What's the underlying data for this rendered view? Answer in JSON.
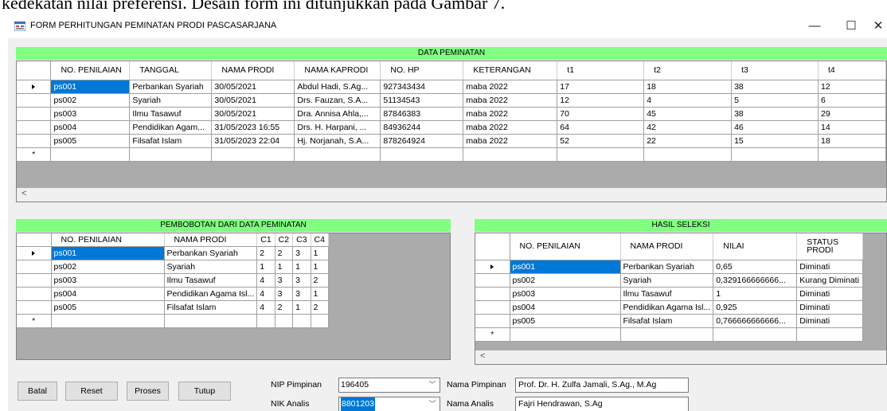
{
  "doc_text": "kedekatan nilai preferensi. Desain form ini ditunjukkan pada Gambar 7.",
  "window": {
    "title": "FORM PERHITUNGAN PEMINATAN PRODI PASCASARJANA",
    "minimize": "—",
    "maximize": "☐",
    "close": "✕"
  },
  "data_peminatan": {
    "title": "DATA PEMINATAN",
    "columns": [
      "NO. PENILAIAN",
      "TANGGAL",
      "NAMA PRODI",
      "NAMA KAPRODI",
      "NO. HP",
      "KETERANGAN",
      "t1",
      "t2",
      "t3",
      "t4"
    ],
    "rows": [
      [
        "ps001",
        "Perbankan Syariah",
        "30/05/2021",
        "Abdul Hadi, S.Ag...",
        "927343434",
        "maba 2022",
        "17",
        "18",
        "38",
        "12"
      ],
      [
        "ps002",
        "Syariah",
        "30/05/2021",
        "Drs. Fauzan, S.A...",
        "51134543",
        "maba 2022",
        "12",
        "4",
        "5",
        "6"
      ],
      [
        "ps003",
        "Ilmu Tasawuf",
        "30/05/2021",
        "Dra. Annisa Ahla,...",
        "87846383",
        "maba 2022",
        "70",
        "45",
        "38",
        "29"
      ],
      [
        "ps004",
        "Pendidikan Agam...",
        "31/05/2023 16:55",
        "Drs. H. Harpani, ...",
        "84936244",
        "maba 2022",
        "64",
        "42",
        "46",
        "14"
      ],
      [
        "ps005",
        "Filsafat Islam",
        "31/05/2023 22:04",
        "Hj. Norjanah, S.A...",
        "878264924",
        "maba 2022",
        "52",
        "22",
        "15",
        "18"
      ]
    ],
    "scroll_left": "<"
  },
  "pembobotan": {
    "title": "PEMBOBOTAN DARI DATA PEMINATAN",
    "columns": [
      "NO. PENILAIAN",
      "NAMA PRODI",
      "C1",
      "C2",
      "C3",
      "C4"
    ],
    "rows": [
      [
        "ps001",
        "Perbankan Syariah",
        "2",
        "2",
        "3",
        "1"
      ],
      [
        "ps002",
        "Syariah",
        "1",
        "1",
        "1",
        "1"
      ],
      [
        "ps003",
        "Ilmu Tasawuf",
        "4",
        "3",
        "3",
        "2"
      ],
      [
        "ps004",
        "Pendidikan Agama Isl...",
        "4",
        "3",
        "3",
        "1"
      ],
      [
        "ps005",
        "Filsafat Islam",
        "4",
        "2",
        "1",
        "2"
      ]
    ]
  },
  "hasil_seleksi": {
    "title": "HASIL SELEKSI",
    "columns": [
      "NO. PENILAIAN",
      "NAMA PRODI",
      "NILAI",
      "STATUS PRODI"
    ],
    "rows": [
      [
        "ps001",
        "Perbankan Syariah",
        "0,65",
        "Diminati"
      ],
      [
        "ps002",
        "Syariah",
        "0,329166666666...",
        "Kurang Diminati"
      ],
      [
        "ps003",
        "Ilmu Tasawuf",
        "1",
        "Diminati"
      ],
      [
        "ps004",
        "Pendidikan Agama Isl...",
        "0,925",
        "Diminati"
      ],
      [
        "ps005",
        "Filsafat Islam",
        "0,766666666666...",
        "Diminati"
      ]
    ],
    "scroll_left": "<"
  },
  "buttons": {
    "batal": "Batal",
    "reset": "Reset",
    "proses": "Proses",
    "tutup": "Tutup"
  },
  "form": {
    "nip_pimpinan_label": "NIP Pimpinan",
    "nip_pimpinan_value": "196405",
    "nik_analis_label": "NIK Analis",
    "nik_analis_value": "8801203",
    "nama_pimpinan_label": "Nama Pimpinan",
    "nama_pimpinan_value": "Prof. Dr. H. Zulfa Jamali, S.Ag., M.Ag",
    "nama_analis_label": "Nama Analis",
    "nama_analis_value": "Fajri Hendrawan, S.Ag",
    "dropdown_glyph": "﹀"
  }
}
